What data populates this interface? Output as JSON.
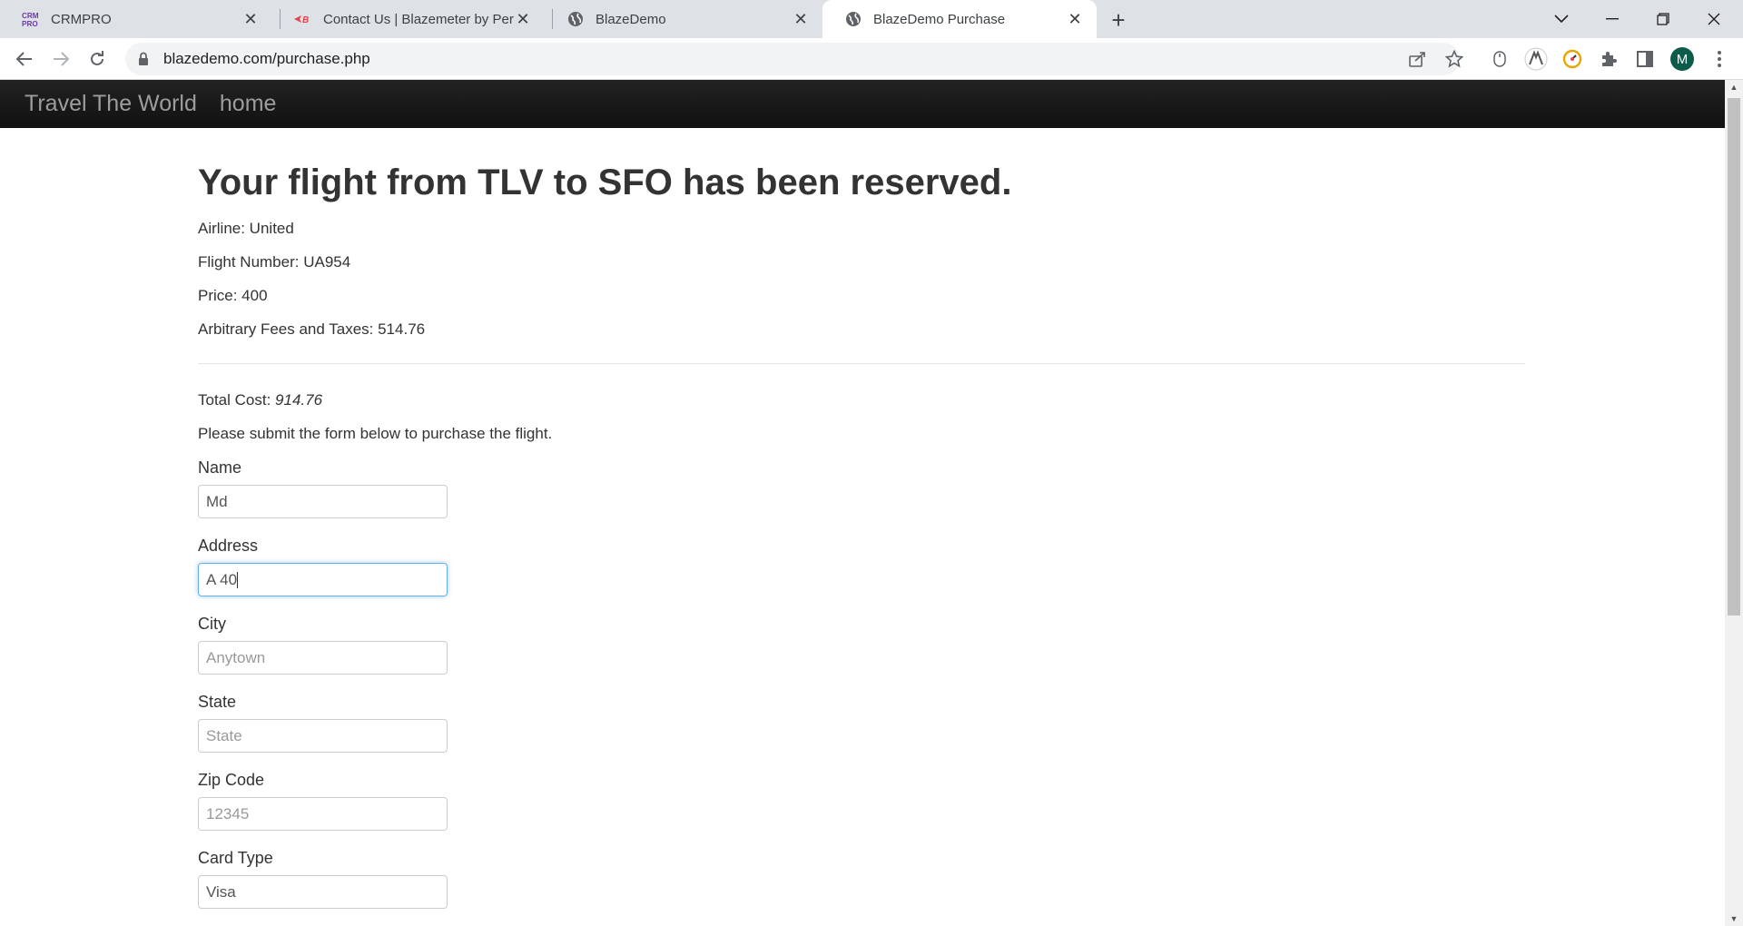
{
  "tabs": [
    {
      "title": "CRMPRO",
      "favicon": "crmpro-icon"
    },
    {
      "title": "Contact Us | Blazemeter by Perforce",
      "favicon": "blazemeter-icon"
    },
    {
      "title": "BlazeDemo",
      "favicon": "globe-icon"
    },
    {
      "title": "BlazeDemo Purchase",
      "favicon": "globe-icon",
      "active": true
    }
  ],
  "address_bar": {
    "url": "blazedemo.com/purchase.php"
  },
  "profile": {
    "initial": "M",
    "color": "#0d5c4b"
  },
  "navbar": {
    "brand": "Travel The World",
    "home_link": "home"
  },
  "reservation": {
    "headline": "Your flight from TLV to SFO has been reserved.",
    "airline": "Airline: United",
    "flight_number": "Flight Number: UA954",
    "price": "Price: 400",
    "fees": "Arbitrary Fees and Taxes: 514.76",
    "total_label": "Total Cost: ",
    "total_value": "914.76",
    "instruction": "Please submit the form below to purchase the flight."
  },
  "form": {
    "name": {
      "label": "Name",
      "value": "Md",
      "placeholder": ""
    },
    "address": {
      "label": "Address",
      "value": "A 40",
      "placeholder": ""
    },
    "city": {
      "label": "City",
      "value": "",
      "placeholder": "Anytown"
    },
    "state": {
      "label": "State",
      "value": "",
      "placeholder": "State"
    },
    "zip": {
      "label": "Zip Code",
      "value": "",
      "placeholder": "12345"
    },
    "card_type": {
      "label": "Card Type",
      "value": "Visa"
    }
  }
}
